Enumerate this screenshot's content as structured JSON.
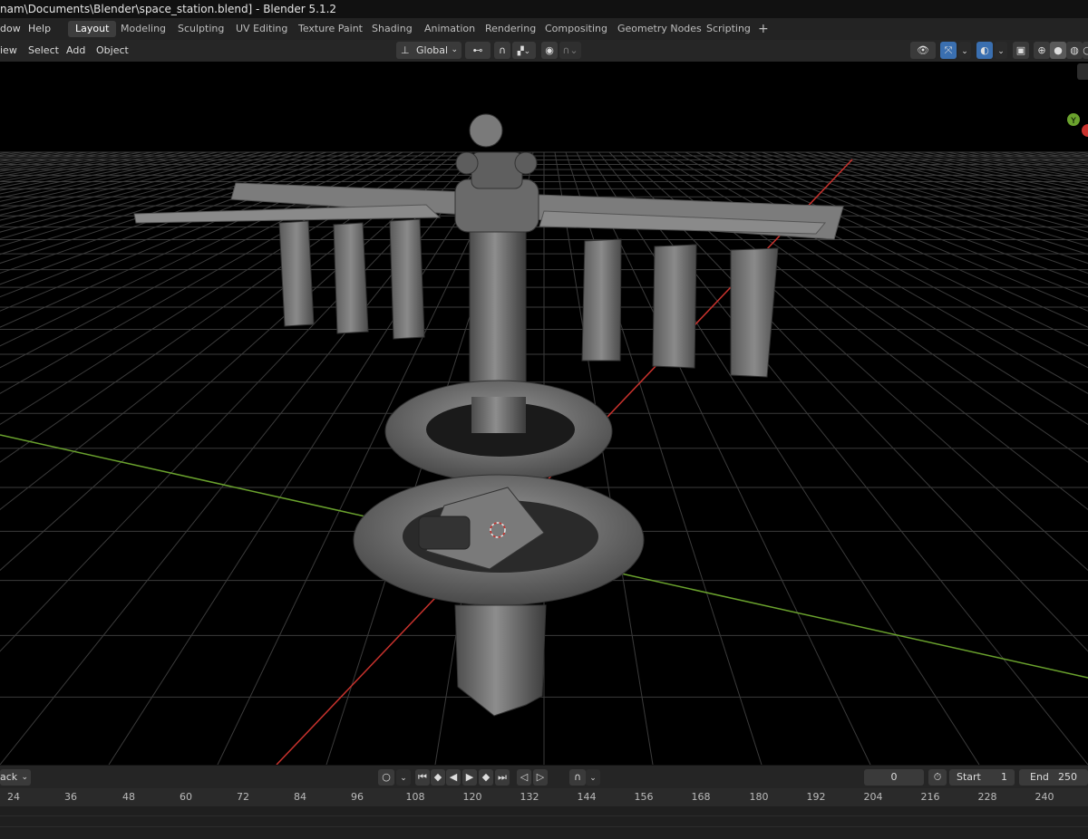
{
  "window": {
    "title": "nam\\Documents\\Blender\\space_station.blend] - Blender 5.1.2"
  },
  "menu": {
    "items": [
      "dow",
      "Help"
    ]
  },
  "workspaces": [
    {
      "label": "Layout",
      "active": true
    },
    {
      "label": "Modeling"
    },
    {
      "label": "Sculpting"
    },
    {
      "label": "UV Editing"
    },
    {
      "label": "Texture Paint"
    },
    {
      "label": "Shading"
    },
    {
      "label": "Animation"
    },
    {
      "label": "Rendering"
    },
    {
      "label": "Compositing"
    },
    {
      "label": "Geometry Nodes"
    },
    {
      "label": "Scripting"
    }
  ],
  "add_workspace": "+",
  "viewport_menu": {
    "view": "iew",
    "select": "Select",
    "add": "Add",
    "object": "Object"
  },
  "transform": {
    "orientation": "Global"
  },
  "gizmo": {
    "y_label": "Y"
  },
  "timeline": {
    "playback_label": "ack",
    "current_frame": "0",
    "start_label": "Start",
    "start_value": "1",
    "end_label": "End",
    "end_value": "250",
    "ruler": [
      "24",
      "36",
      "48",
      "60",
      "72",
      "84",
      "96",
      "108",
      "120",
      "132",
      "144",
      "156",
      "168",
      "180",
      "192",
      "204",
      "216",
      "228",
      "240"
    ]
  },
  "colors": {
    "x_axis": "#c8322d",
    "y_axis": "#6aa22d",
    "grid": "#3b3b3b",
    "active_tab": "#3d3d3d",
    "gizmo_blue": "#3a6fb0"
  }
}
